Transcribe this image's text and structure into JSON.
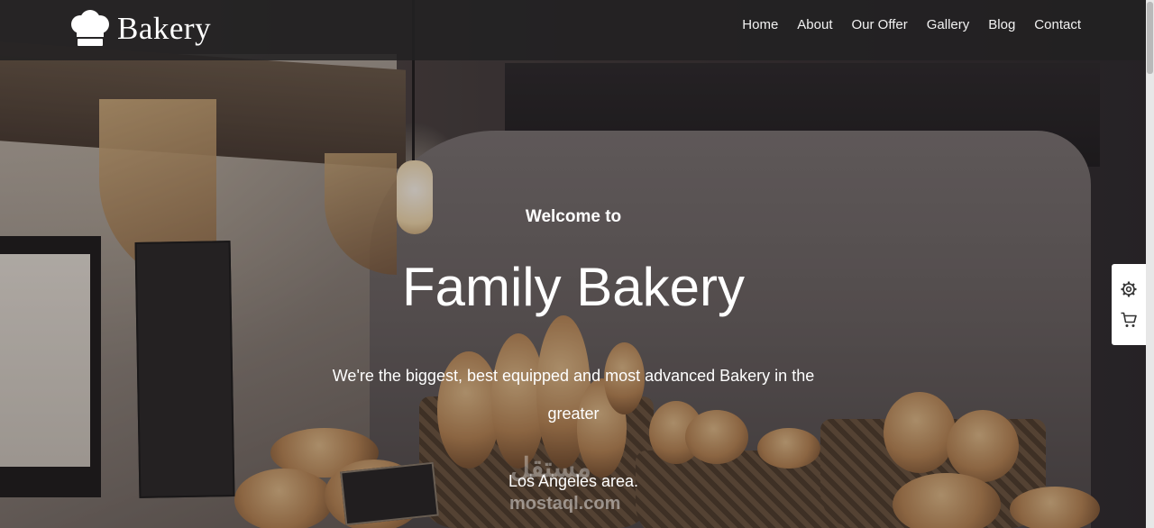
{
  "header": {
    "brand_name": "Bakery",
    "brand_icon": "chef-hat-icon",
    "nav": [
      "Home",
      "About",
      "Our Offer",
      "Gallery",
      "Blog",
      "Contact"
    ]
  },
  "hero": {
    "welcome": "Welcome to",
    "title": "Family Bakery",
    "description_line1": "We're the biggest, best equipped and most advanced Bakery in the",
    "description_line2": "greater",
    "description_line3": "Los Angeles area."
  },
  "side_widget": {
    "icons": [
      "gear-icon",
      "cart-icon"
    ]
  },
  "watermark": {
    "text_arabic": "مستقل",
    "text_latin": "mostaql.com"
  },
  "colors": {
    "header_bg": "#222122",
    "text": "#ffffff"
  }
}
